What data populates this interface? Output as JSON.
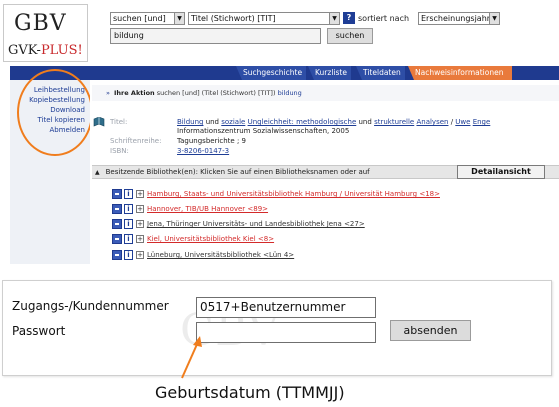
{
  "logo": {
    "line1": "GBV",
    "line2_prefix": "GVK-",
    "line2_accent": "PLUS!"
  },
  "search": {
    "operator": "suchen [und]",
    "field": "Titel (Stichwort) [TIT]",
    "sort_label": "sortiert nach",
    "sort_value": "Erscheinungsjahr",
    "help_glyph": "?",
    "query": "bildung",
    "button": "suchen"
  },
  "tabs": [
    "Suchgeschichte",
    "Kurzliste",
    "Titeldaten",
    "Nachweisinformationen"
  ],
  "active_tab": "Nachweisinformationen",
  "sidebar": {
    "items": [
      "Leihbestellung",
      "Kopiebestellung",
      "Download",
      "Titel kopieren",
      "Abmelden"
    ]
  },
  "action": {
    "prefix": "Ihre Aktion",
    "text": "suchen [und] (Titel (Stichwort) [TIT])",
    "query": "bildung"
  },
  "record": {
    "title_label": "Titel:",
    "title_parts": [
      "Bildung",
      "und",
      "soziale",
      "Ungleichheit",
      ": methodologische",
      "und",
      "strukturelle",
      "Analysen",
      "/",
      "Uwe",
      "Enge"
    ],
    "publisher": "Informationszentrum Sozialwissenschaften, 2005",
    "series_label": "Schriftenreihe:",
    "series": "Tagungsberichte ; 9",
    "isbn_label": "ISBN:",
    "isbn": "3-8206-0147-3"
  },
  "holdings": {
    "header": "Besitzende Bibliothek(en): Klicken Sie auf einen Bibliotheksnamen oder auf",
    "detail_button": "Detailansicht",
    "libraries": [
      {
        "name": "Hamburg, Staats- und Universitätsbibliothek Hamburg / Universität Hamburg <18>",
        "color": "red"
      },
      {
        "name": "Hannover, TIB/UB Hannover <89>",
        "color": "red"
      },
      {
        "name": "Jena, Thüringer Universitäts- und Landesbibliothek Jena <27>",
        "color": "dark"
      },
      {
        "name": "Kiel, Universitätsbibliothek Kiel <8>",
        "color": "red"
      },
      {
        "name": "Lüneburg, Universitätsbibliothek <Lün 4>",
        "color": "dark"
      }
    ]
  },
  "login": {
    "user_label": "Zugangs-/Kundennummer",
    "user_value": "0517+Benutzernummer",
    "password_label": "Passwort",
    "password_value": "",
    "submit": "absenden"
  },
  "annotation": "Geburtsdatum (TTMMJJ)",
  "colors": {
    "nav": "#1f3a8f",
    "active_tab": "#e97a3c",
    "highlight": "#f07d1d",
    "link_red": "#d32a2a"
  },
  "icons": [
    "book-icon",
    "order-icon",
    "info-icon",
    "expand-icon",
    "help-icon",
    "dropdown-arrow-icon"
  ]
}
